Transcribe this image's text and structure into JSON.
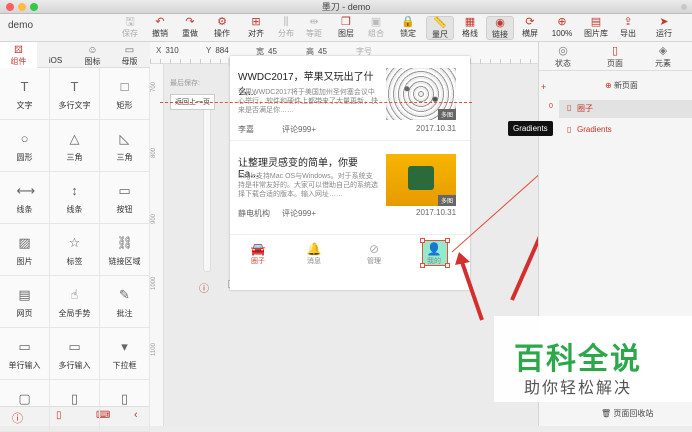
{
  "window": {
    "title": "墨刀 - demo",
    "doc_name": "demo"
  },
  "toolbar": {
    "items": [
      {
        "label": "保存",
        "icon": "save-icon",
        "glyph": "🖫",
        "disabled": true
      },
      {
        "label": "撤销",
        "icon": "undo-icon",
        "glyph": "↶"
      },
      {
        "label": "重做",
        "icon": "redo-icon",
        "glyph": "↷"
      },
      {
        "label": "操作",
        "icon": "gear-icon",
        "glyph": "⚙"
      },
      {
        "label": "对齐",
        "icon": "align-icon",
        "glyph": "⊞"
      },
      {
        "label": "分布",
        "icon": "distribute-icon",
        "glyph": "⫼",
        "disabled": true
      },
      {
        "label": "等距",
        "icon": "equal-spacing-icon",
        "glyph": "⇹",
        "disabled": true
      },
      {
        "label": "图层",
        "icon": "layers-icon",
        "glyph": "❐"
      },
      {
        "label": "组合",
        "icon": "group-icon",
        "glyph": "▣",
        "disabled": true
      },
      {
        "label": "锁定",
        "icon": "lock-icon",
        "glyph": "🔒"
      },
      {
        "label": "量尺",
        "icon": "ruler-icon",
        "glyph": "📏",
        "active": true
      },
      {
        "label": "格线",
        "icon": "grid-icon",
        "glyph": "▦"
      },
      {
        "label": "链接",
        "icon": "link-icon",
        "glyph": "◉",
        "active": true
      },
      {
        "label": "横屏",
        "icon": "rotate-icon",
        "glyph": "⟳"
      },
      {
        "label": "100%",
        "icon": "zoom-icon",
        "glyph": "⊕"
      },
      {
        "label": "图片库",
        "icon": "image-library-icon",
        "glyph": "▤"
      },
      {
        "label": "导出",
        "icon": "export-icon",
        "glyph": "⇪"
      },
      {
        "label": "运行",
        "icon": "run-icon",
        "glyph": "➤"
      }
    ]
  },
  "left_panel": {
    "tabs": [
      {
        "label": "组件",
        "icon": "components-icon",
        "glyph": "⚄",
        "active": true
      },
      {
        "label": "iOS",
        "icon": "apple-icon",
        "glyph": ""
      },
      {
        "label": "图标",
        "icon": "emoji-icon",
        "glyph": "☺"
      },
      {
        "label": "母版",
        "icon": "master-icon",
        "glyph": "▭"
      }
    ],
    "components": [
      {
        "label": "文字",
        "icon": "text-icon",
        "glyph": "T"
      },
      {
        "label": "多行文字",
        "icon": "multiline-text-icon",
        "glyph": "T"
      },
      {
        "label": "矩形",
        "icon": "rectangle-icon",
        "glyph": "□"
      },
      {
        "label": "圆形",
        "icon": "circle-icon",
        "glyph": "○"
      },
      {
        "label": "三角",
        "icon": "triangle-icon",
        "glyph": "△"
      },
      {
        "label": "三角",
        "icon": "right-triangle-icon",
        "glyph": "◺"
      },
      {
        "label": "线条",
        "icon": "horizontal-line-icon",
        "glyph": "⟷"
      },
      {
        "label": "线条",
        "icon": "vertical-line-icon",
        "glyph": "↕"
      },
      {
        "label": "按钮",
        "icon": "button-icon",
        "glyph": "▭"
      },
      {
        "label": "图片",
        "icon": "image-icon",
        "glyph": "▨"
      },
      {
        "label": "标签",
        "icon": "star-icon",
        "glyph": "☆"
      },
      {
        "label": "链接区域",
        "icon": "link-area-icon",
        "glyph": "⛓"
      },
      {
        "label": "网页",
        "icon": "webpage-icon",
        "glyph": "▤"
      },
      {
        "label": "全局手势",
        "icon": "gesture-icon",
        "glyph": "☝"
      },
      {
        "label": "批注",
        "icon": "annotation-icon",
        "glyph": "✎"
      },
      {
        "label": "单行输入",
        "icon": "single-input-icon",
        "glyph": "▭"
      },
      {
        "label": "多行输入",
        "icon": "multi-input-icon",
        "glyph": "▭"
      },
      {
        "label": "下拉框",
        "icon": "dropdown-icon",
        "glyph": "▾"
      },
      {
        "label": "",
        "icon": "folder-icon",
        "glyph": "▢"
      },
      {
        "label": "",
        "icon": "phone-icon",
        "glyph": "▯"
      },
      {
        "label": "",
        "icon": "tablet-icon",
        "glyph": "▯"
      }
    ]
  },
  "coords": {
    "x_label": "X",
    "x": "310",
    "y_label": "Y",
    "y": "884",
    "w_label": "宽",
    "w": "45",
    "h_label": "高",
    "h": "45",
    "size_placeholder": "字号"
  },
  "history": {
    "label": "最后保存:",
    "back_button": "返回上一页"
  },
  "ruler": {
    "v_ticks": [
      "700",
      "800",
      "900",
      "1000",
      "1100"
    ]
  },
  "article1": {
    "title": "WWDC2017，苹果又玩出了什么...",
    "text": "苹果WWDC2017将于美国加州圣何塞会议中心举行，软件和硬件上都带来了大量更新，快来是否满足你……",
    "author": "李嘉",
    "comments": "评论999+",
    "date": "2017.10.31",
    "tag": "多图"
  },
  "article2": {
    "title": "让整理灵感变的简单，你要Ea...",
    "text": "Eagle支持Mac OS与Windows。对于系统支持是非常友好的。大家可以借助自己的系统选择下载合适的版本。输入网址……",
    "author": "静电机构",
    "comments": "评论999+",
    "date": "2017.10.31",
    "tag": "多图"
  },
  "bottom_nav": [
    {
      "label": "圈子",
      "icon": "car-icon",
      "glyph": "🚘",
      "active": true
    },
    {
      "label": "消息",
      "icon": "bell-icon",
      "glyph": "🔔"
    },
    {
      "label": "管理",
      "icon": "compass-icon",
      "glyph": "⊘"
    },
    {
      "label": "我的",
      "icon": "user-icon",
      "glyph": "👤"
    }
  ],
  "right_panel": {
    "tabs": [
      {
        "label": "状态",
        "icon": "state-icon",
        "glyph": "◎"
      },
      {
        "label": "页面",
        "icon": "page-icon",
        "glyph": "▯",
        "active": true
      },
      {
        "label": "元素",
        "icon": "elements-icon",
        "glyph": "◈"
      }
    ],
    "new_page": "新页面",
    "pages": [
      {
        "label": "圈子",
        "index": "0",
        "selected": true
      },
      {
        "label": "Gradients",
        "index": ""
      }
    ],
    "trash": "页面回收站"
  },
  "tooltip": "Gradients",
  "watermark": {
    "title": "百科全说",
    "subtitle": "助你轻松解决"
  },
  "colors": {
    "accent": "#c0392b",
    "nav_active": "#e74c3c",
    "selection": "#e74c3c",
    "highlight": "#7ee8c3"
  }
}
